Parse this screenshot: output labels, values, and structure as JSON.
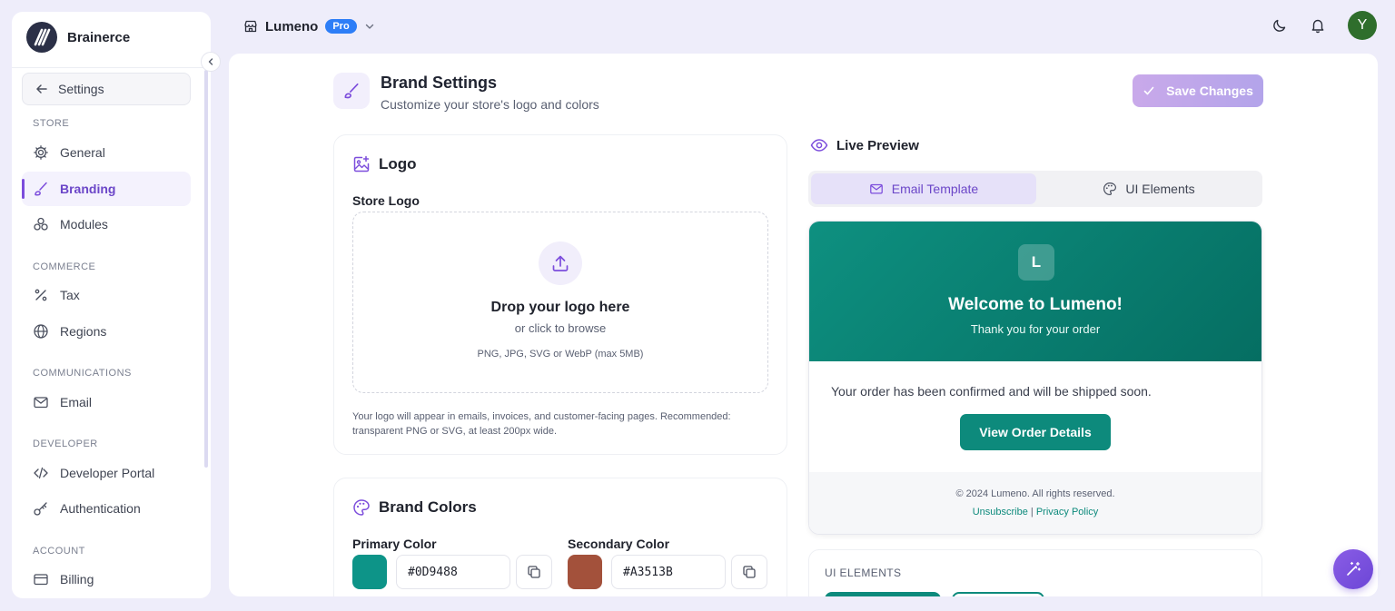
{
  "app": {
    "name": "Brainerce"
  },
  "topbar": {
    "store_name": "Lumeno",
    "plan_badge": "Pro",
    "avatar_initial": "Y"
  },
  "sidebar": {
    "back_label": "Settings",
    "sections": [
      {
        "label": "STORE",
        "items": [
          {
            "label": "General",
            "icon": "gear-icon"
          },
          {
            "label": "Branding",
            "icon": "brush-icon",
            "active": true
          },
          {
            "label": "Modules",
            "icon": "modules-icon"
          }
        ]
      },
      {
        "label": "COMMERCE",
        "items": [
          {
            "label": "Tax",
            "icon": "percent-icon"
          },
          {
            "label": "Regions",
            "icon": "globe-icon"
          }
        ]
      },
      {
        "label": "COMMUNICATIONS",
        "items": [
          {
            "label": "Email",
            "icon": "mail-icon"
          }
        ]
      },
      {
        "label": "DEVELOPER",
        "items": [
          {
            "label": "Developer Portal",
            "icon": "code-icon"
          },
          {
            "label": "Authentication",
            "icon": "key-icon"
          }
        ]
      },
      {
        "label": "ACCOUNT",
        "items": [
          {
            "label": "Billing",
            "icon": "card-icon"
          }
        ]
      }
    ]
  },
  "page": {
    "title": "Brand Settings",
    "subtitle": "Customize your store's logo and colors",
    "save_label": "Save Changes"
  },
  "logo_card": {
    "title": "Logo",
    "field_label": "Store Logo",
    "drop_title": "Drop your logo here",
    "drop_sub": "or click to browse",
    "drop_types": "PNG, JPG, SVG or WebP (max 5MB)",
    "note": "Your logo will appear in emails, invoices, and customer-facing pages. Recommended: transparent PNG or SVG, at least 200px wide."
  },
  "colors_card": {
    "title": "Brand Colors",
    "primary": {
      "label": "Primary Color",
      "hex": "#0D9488"
    },
    "secondary": {
      "label": "Secondary Color",
      "hex": "#A3513B"
    }
  },
  "preview": {
    "title": "Live Preview",
    "tabs": [
      {
        "label": "Email Template",
        "active": true
      },
      {
        "label": "UI Elements",
        "active": false
      }
    ],
    "email": {
      "badge": "L",
      "welcome": "Welcome to Lumeno!",
      "thanks": "Thank you for your order",
      "body": "Your order has been confirmed and will be shipped soon.",
      "cta": "View Order Details",
      "copyright": "© 2024 Lumeno. All rights reserved.",
      "link_unsubscribe": "Unsubscribe",
      "link_separator": "|",
      "link_privacy": "Privacy Policy"
    },
    "ui_elements_label": "UI ELEMENTS"
  },
  "colors": {
    "accent": "#7C4DDC",
    "primary": "#0D9488",
    "secondary": "#A3513B"
  }
}
